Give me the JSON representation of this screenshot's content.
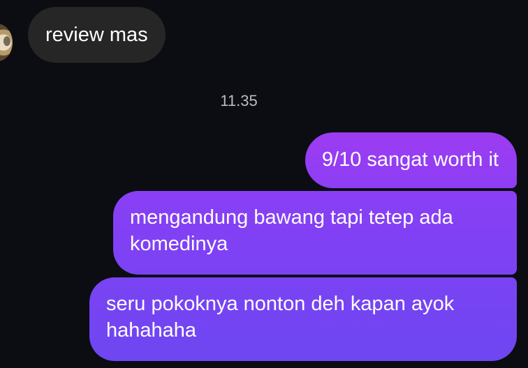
{
  "chat": {
    "incoming": {
      "message": "review mas"
    },
    "timestamp": "11.35",
    "outgoing": [
      {
        "lines": [
          "9/10 sangat worth it"
        ]
      },
      {
        "lines": [
          "mengandung bawang tapi tetep ada",
          "komedinya"
        ]
      },
      {
        "lines": [
          "seru pokoknya nonton deh kapan ayok",
          "hahahaha"
        ]
      }
    ]
  },
  "colors": {
    "background": "#0b0d12",
    "incoming_bubble": "#262626",
    "outgoing_bubble_top": "#9d3cf2",
    "outgoing_bubble_bottom": "#6e46f1",
    "timestamp": "#b8bcc3"
  },
  "icons": {
    "sender_avatar": "avatar"
  }
}
